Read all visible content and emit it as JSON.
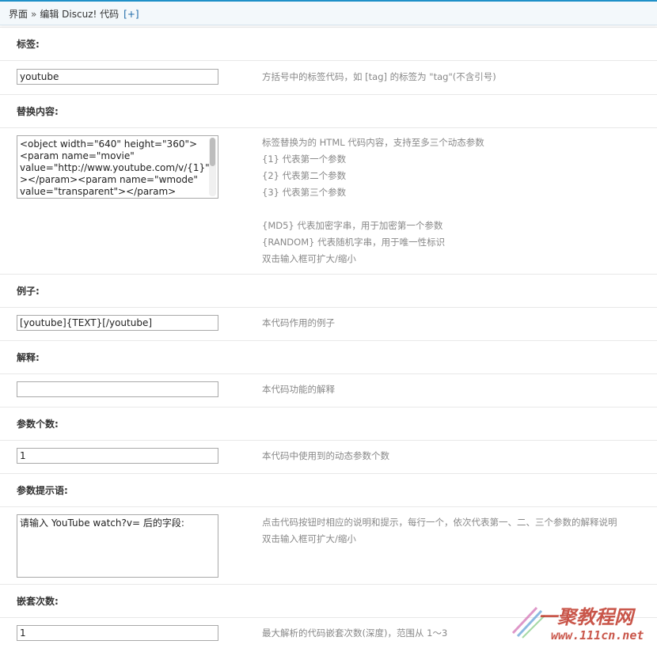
{
  "header": {
    "crumb_1": "界面",
    "separator": "»",
    "crumb_2": "编辑 Discuz! 代码",
    "add_link": "[+]"
  },
  "fields": {
    "tag": {
      "label": "标签:",
      "value": "youtube",
      "tip": "方括号中的标签代码，如 [tag] 的标签为 \"tag\"(不含引号)"
    },
    "replacement": {
      "label": "替换内容:",
      "value_lines": [
        "<object width=\"640\" height=\"360\">",
        "<param name=\"movie\"",
        "value=\"http://www.youtube.com/v/{1}\"",
        "></param><param name=\"wmode\"",
        "value=\"transparent\"></param>"
      ],
      "tips": {
        "t0": "标签替换为的 HTML 代码内容，支持至多三个动态参数",
        "t1": "{1} 代表第一个参数",
        "t2": "{2} 代表第二个参数",
        "t3": "{3} 代表第三个参数",
        "t4": "{MD5} 代表加密字串，用于加密第一个参数",
        "t5": "{RANDOM} 代表随机字串，用于唯一性标识",
        "t6": "双击输入框可扩大/缩小"
      }
    },
    "example": {
      "label": "例子:",
      "value": "[youtube]{TEXT}[/youtube]",
      "tip": "本代码作用的例子"
    },
    "explanation": {
      "label": "解释:",
      "value": "",
      "tip": "本代码功能的解释"
    },
    "param_count": {
      "label": "参数个数:",
      "value": "1",
      "tip": "本代码中使用到的动态参数个数"
    },
    "param_prompt": {
      "label": "参数提示语:",
      "value": "请输入 YouTube watch?v= 后的字段:",
      "tip_1": "点击代码按钮时相应的说明和提示，每行一个，依次代表第一、二、三个参数的解释说明",
      "tip_2": "双击输入框可扩大/缩小"
    },
    "nest_count": {
      "label": "嵌套次数:",
      "value": "1",
      "tip": "最大解析的代码嵌套次数(深度)，范围从 1～3"
    }
  },
  "watermark": {
    "text_1": "一聚教程网",
    "text_2": "www.111cn.net"
  },
  "colors": {
    "accent": "#1e90c8",
    "tip_text": "#888888",
    "watermark_red": "#c0392b"
  }
}
